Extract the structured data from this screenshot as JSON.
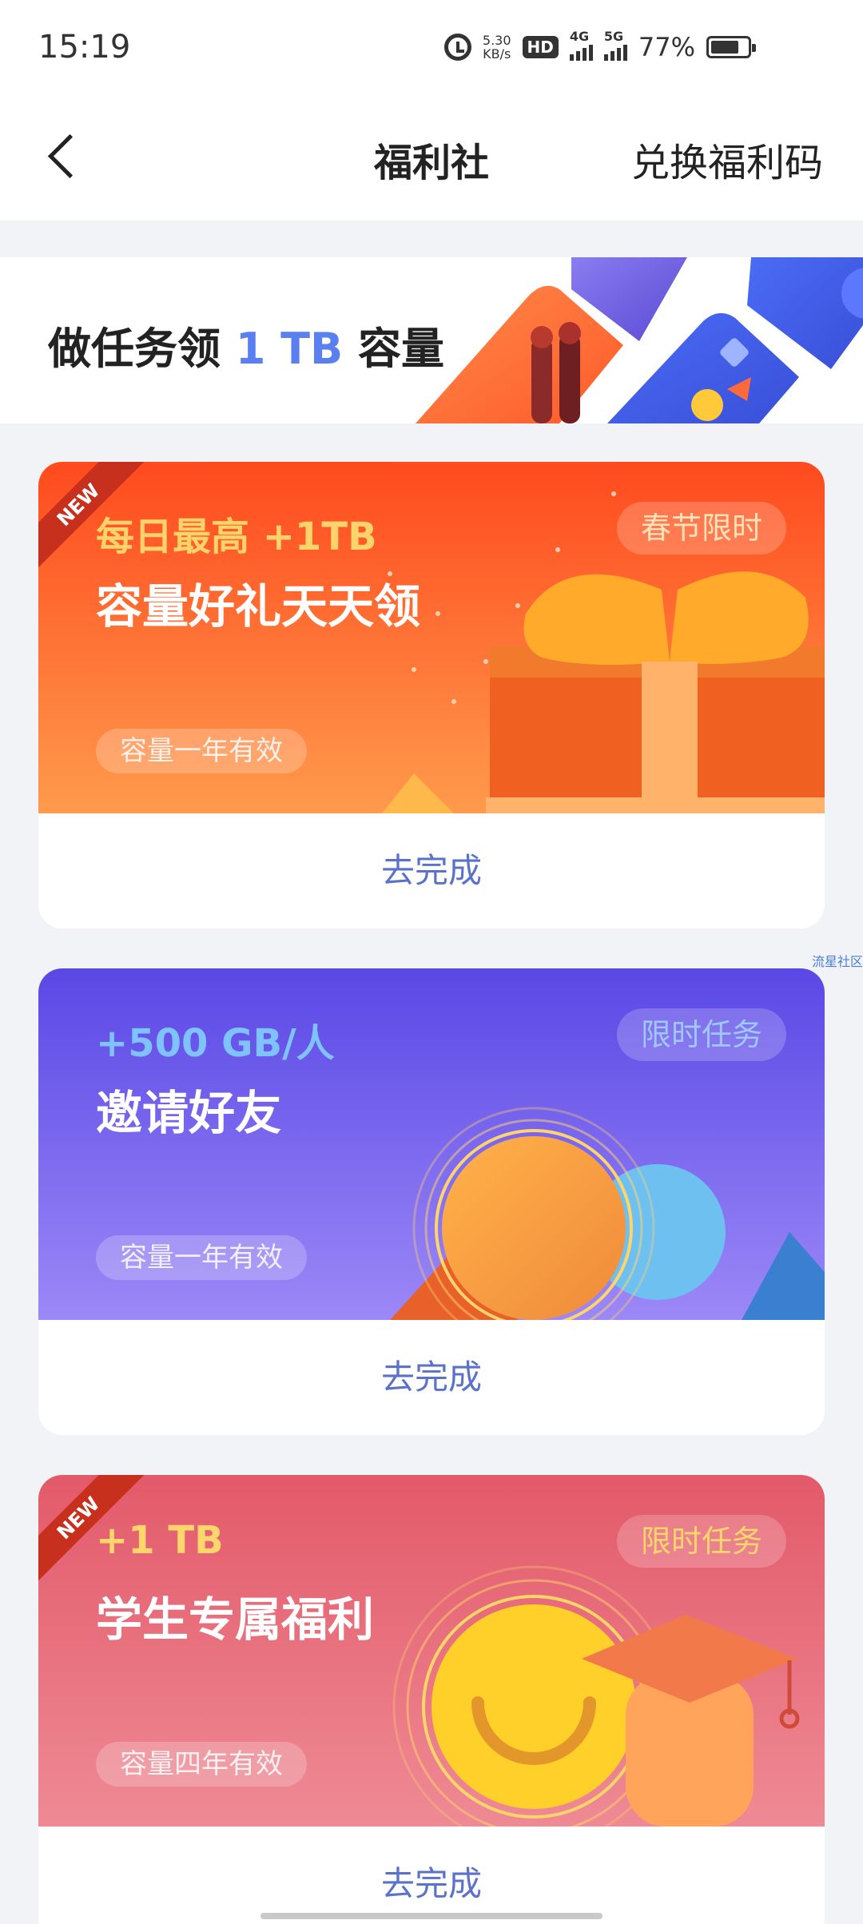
{
  "status_bar": {
    "time": "15:19",
    "net_speed_value": "5.30",
    "net_speed_unit": "KB/s",
    "hd_label": "HD",
    "sim1_label": "4G",
    "sim2_label": "5G",
    "battery": "77%",
    "battery_level": 0.77
  },
  "header": {
    "title": "福利社",
    "redeem_label": "兑换福利码"
  },
  "banner": {
    "text_prefix": "做任务领",
    "text_highlight": "1 TB",
    "text_suffix": "容量"
  },
  "cards": [
    {
      "ribbon": "NEW",
      "subtitle": "每日最高  +1TB",
      "title": "容量好礼天天领",
      "tag": "春节限时",
      "validity": "容量一年有效",
      "action": "去完成",
      "colors": {
        "bg_from": "#ff4d1f",
        "bg_to": "#ff9a4a",
        "accent": "#ffd36b",
        "tag_text": "#ffe2b5"
      }
    },
    {
      "ribbon": "",
      "subtitle": "+500  GB/人",
      "title": "邀请好友",
      "tag": "限时任务",
      "validity": "容量一年有效",
      "action": "去完成",
      "colors": {
        "bg_from": "#5b4ae8",
        "bg_to": "#9a86f6",
        "accent": "#7ec3ff",
        "tag_text": "#9ec8ff"
      }
    },
    {
      "ribbon": "NEW",
      "subtitle": "+1  TB",
      "title": "学生专属福利",
      "tag": "限时任务",
      "validity": "容量四年有效",
      "action": "去完成",
      "colors": {
        "bg_from": "#e35a6a",
        "bg_to": "#ee8a92",
        "accent": "#ffd66b",
        "tag_text": "#ffd66b"
      }
    }
  ],
  "watermark": "流星社区"
}
